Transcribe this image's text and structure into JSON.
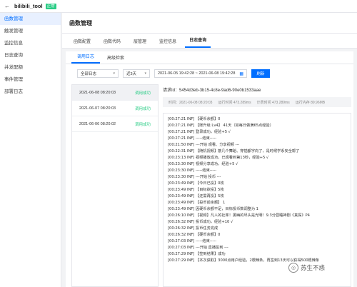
{
  "app": {
    "back_icon": "back-arrow-icon",
    "name": "bilibili_tool",
    "badge": "正常"
  },
  "sidebar": {
    "items": [
      {
        "label": "函数管理",
        "active": true
      },
      {
        "label": "触发管理",
        "active": false
      },
      {
        "label": "监控信息",
        "active": false
      },
      {
        "label": "日志查询",
        "active": false
      },
      {
        "label": "并发配额",
        "active": false
      },
      {
        "label": "事件管理",
        "active": false
      },
      {
        "label": "部署日志",
        "active": false
      }
    ]
  },
  "header": {
    "title": "函数管理"
  },
  "tabs": [
    {
      "label": "函数配置",
      "active": false
    },
    {
      "label": "函数代码",
      "active": false
    },
    {
      "label": "层管理",
      "active": false
    },
    {
      "label": "监控信息",
      "active": false
    },
    {
      "label": "日志查询",
      "active": true
    }
  ],
  "subtabs": [
    {
      "label": "调用日志",
      "active": true
    },
    {
      "label": "高级检索",
      "active": false
    }
  ],
  "filters": {
    "log_type": "全部日志",
    "time_range": "近3天",
    "date_range": "2021-06-05 19:42:28 ~ 2021-06-08 19:42:28",
    "calendar_icon": "calendar-icon",
    "refresh_label": "刷新"
  },
  "invocations": [
    {
      "time": "2021-06-08 08:20:03",
      "status": "调用成功"
    },
    {
      "time": "2021-06-07 08:20:03",
      "status": "调用成功"
    },
    {
      "time": "2021-06-06 08:20:02",
      "status": "调用成功"
    }
  ],
  "detail": {
    "request_id": "请求Id：5454d3eb-3b15-4c8e-9ad6-90e0b1533aae",
    "meta": {
      "time": "时间：2021-06-08 08:20:03",
      "run_time": "运行时间 473.289ms",
      "billing_time": "计费时间 473.289ms",
      "memory": "运行内存 89.96MB"
    },
    "log_lines": [
      "[00:27:21 INF] 【硬币余额】0",
      "[00:27:21 INF] 【账升级 Lv4】 41天（如每日做满65点经验）",
      "[00:27:21 INF] 登录成功，经验+5 √",
      "[00:27:21 INF] -----结束-----",
      "[00:21:50 INF] ---开始 观看、分享视频 ---",
      "[00:22:31 INF] 【随机视频】筋几个舞蹈、穿插都字向了，是时候学系安全帮了",
      "[00:23:13 INF] 视频播放成功，已观看到第13秒，经验+5 √",
      "[00:23:30 INF] 视频分享成功，经验+5 √",
      "[00:23:30 INF] -----结束-----",
      "[00:23:30 INF] ---开始 投币 ---",
      "[00:23:49 INF] 【今日已投】0枚",
      "[00:23:49 INF] 【目标欲投】5枚",
      "[00:23:49 INF] 【还需再投】5枚",
      "[00:23:49 INF] 【投币前余额】 1",
      "[00:23:49 INF] 因硬币余额不足，目标投币数调整为 1",
      "[00:26:10 INF] 【视频】凡人的社率！黑幽的尽头是光明！9.3分昼睡神剧《真探》P4",
      "[00:26:32 INF] 投币成功，经验+10 √",
      "[00:26:32 INF] 投币任务完成",
      "[00:26:32 INF] 【硬币余额】0",
      "[00:27:03 INF] -----结束-----",
      "[00:27:03 INF] ---开始 直播签到 ---",
      "[00:27:29 INF] 【签到结果】成功",
      "[00:27:29 INF] 【本次获取】3000点用户经验，2根辣条，再签到13天可以获得500根辣条"
    ]
  },
  "watermark": {
    "icon": "wechat-account-icon",
    "text": "苏生不惑"
  }
}
